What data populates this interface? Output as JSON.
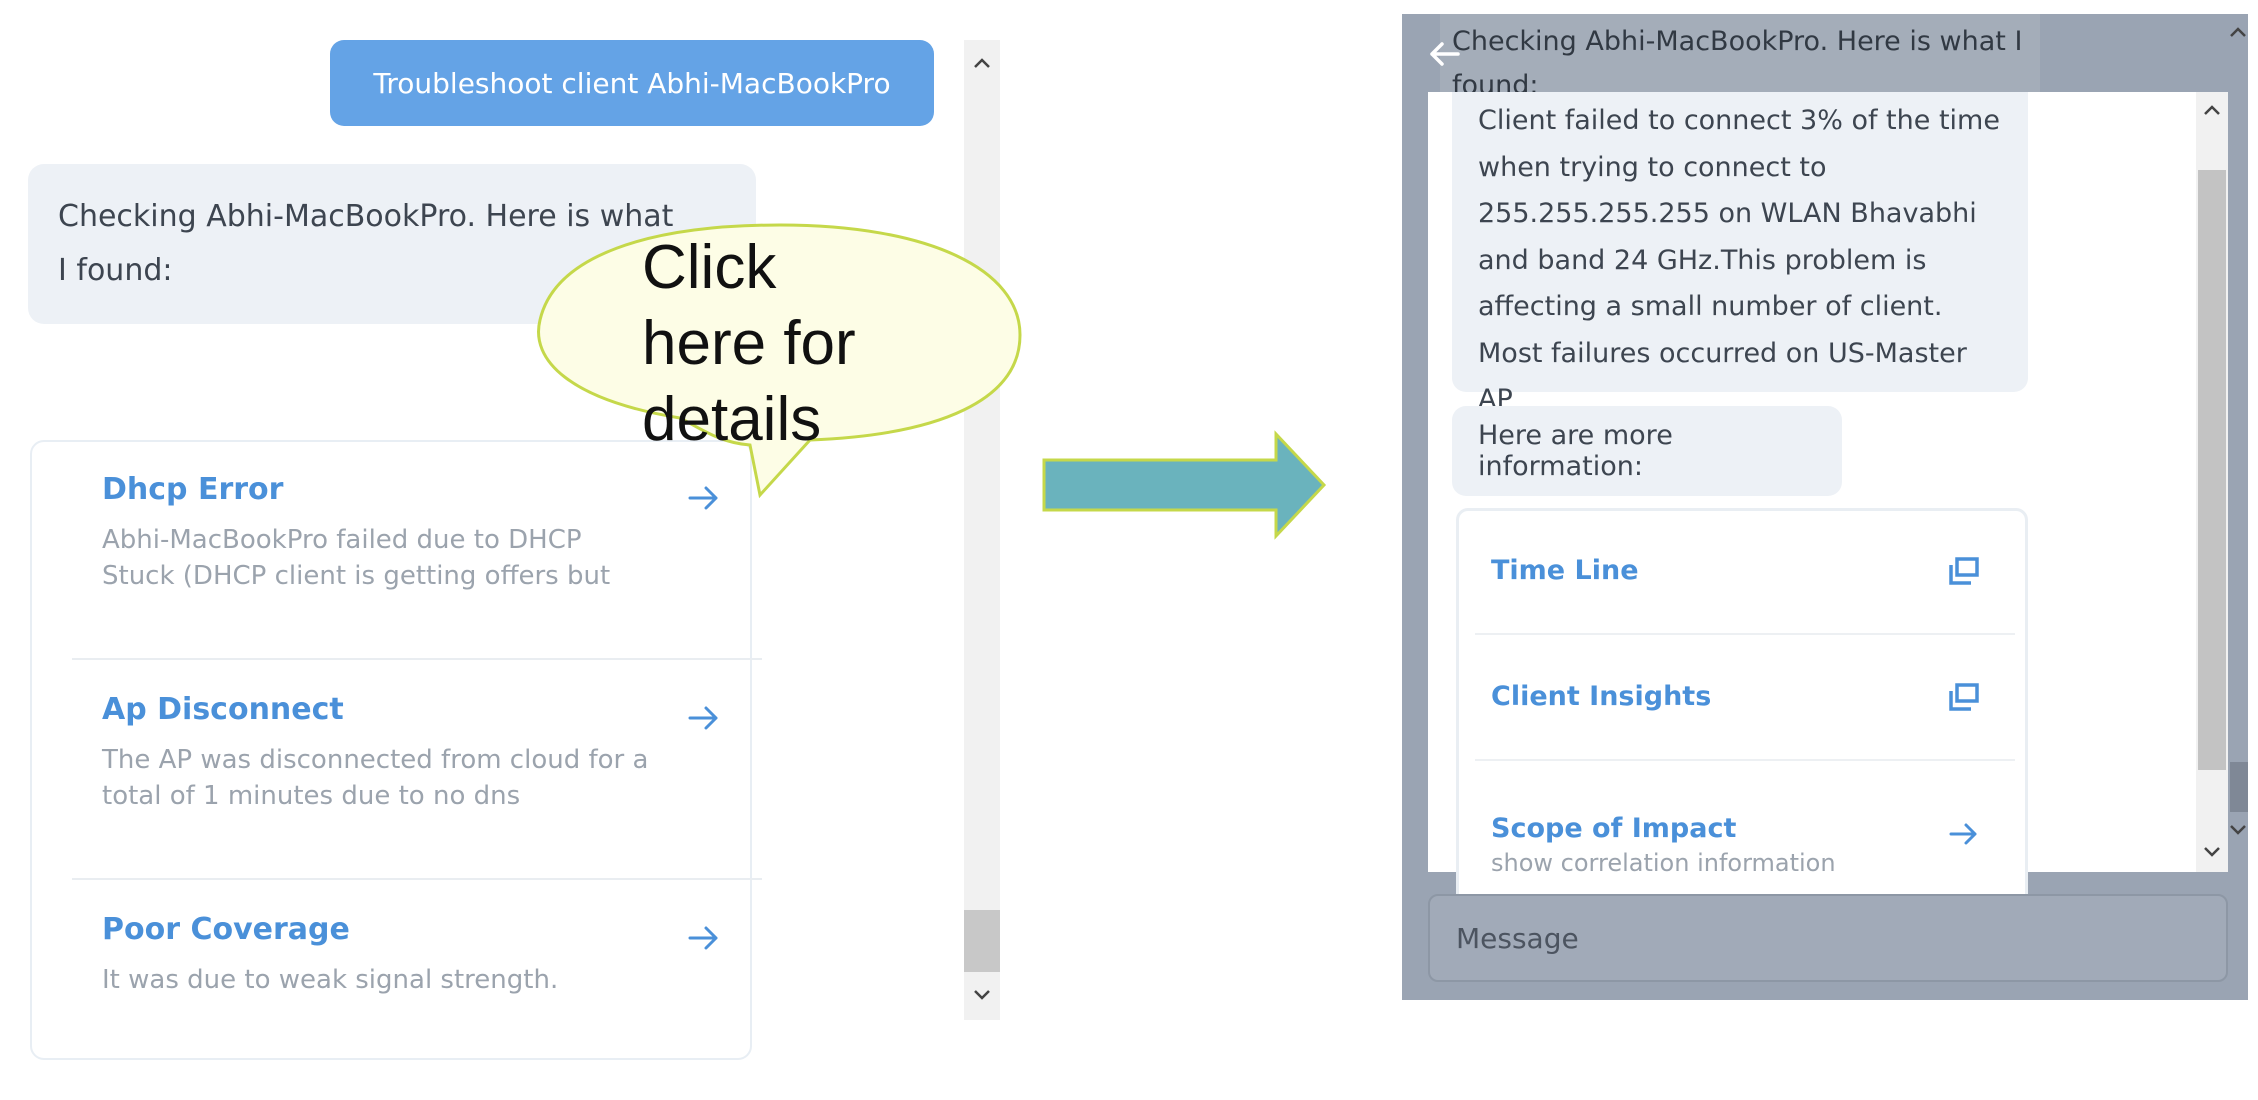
{
  "left_chat": {
    "user_message": "Troubleshoot client Abhi-MacBookPro",
    "bot_message": "Checking Abhi-MacBookPro. Here is what I found:",
    "issues": [
      {
        "title": "Dhcp Error",
        "description": "Abhi-MacBookPro failed due to DHCP Stuck (DHCP client is getting offers but"
      },
      {
        "title": "Ap Disconnect",
        "description": "The AP was disconnected from cloud for a total of 1 minutes due to no dns"
      },
      {
        "title": "Poor Coverage",
        "description": "It was due to weak signal strength."
      }
    ]
  },
  "callout": {
    "text": "Click here for details"
  },
  "right_chat": {
    "heading": "Checking Abhi-MacBookPro. Here is what I found:",
    "detail": "Client failed to connect 3% of the time when trying to connect to 255.255.255.255 on WLAN Bhavabhi and band 24 GHz.This problem is affecting a small number of client. Most failures occurred on US-Master AP",
    "more_info": "Here are more information:",
    "links": [
      {
        "label": "Time Line",
        "icon": "open-window-icon"
      },
      {
        "label": "Client Insights",
        "icon": "open-window-icon"
      },
      {
        "label": "Scope of Impact",
        "sublabel": "show correlation information",
        "icon": "arrow-right-icon"
      }
    ],
    "message_placeholder": "Message"
  },
  "colors": {
    "accent": "#4a90d9",
    "user_bubble": "#64a3e6",
    "bot_bubble": "#edf1f6",
    "overlay": "#9aa4b3",
    "callout_fill": "#fdfde6",
    "callout_stroke": "#c5d84a",
    "arrow_fill": "#6ab3bd"
  }
}
